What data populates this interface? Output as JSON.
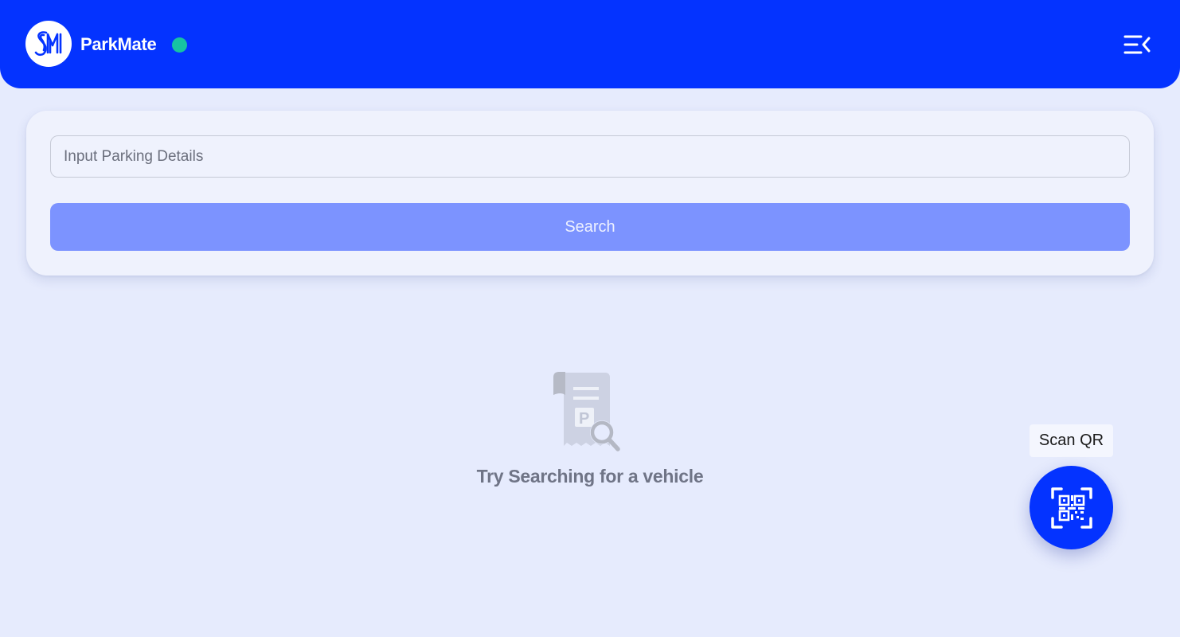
{
  "header": {
    "logo_icon": "sm-logo-icon",
    "app_title": "ParkMate",
    "status_color": "#17c3a2",
    "menu_icon": "collapse-menu-icon",
    "background": "#0433ff"
  },
  "search": {
    "placeholder": "Input Parking Details",
    "value": "",
    "button_label": "Search",
    "button_color": "#7c93ff"
  },
  "empty_state": {
    "icon": "parking-receipt-search-icon",
    "message": "Try Searching for a vehicle"
  },
  "scan": {
    "label": "Scan QR",
    "icon": "qr-code-scan-icon",
    "button_color": "#0433ff"
  }
}
